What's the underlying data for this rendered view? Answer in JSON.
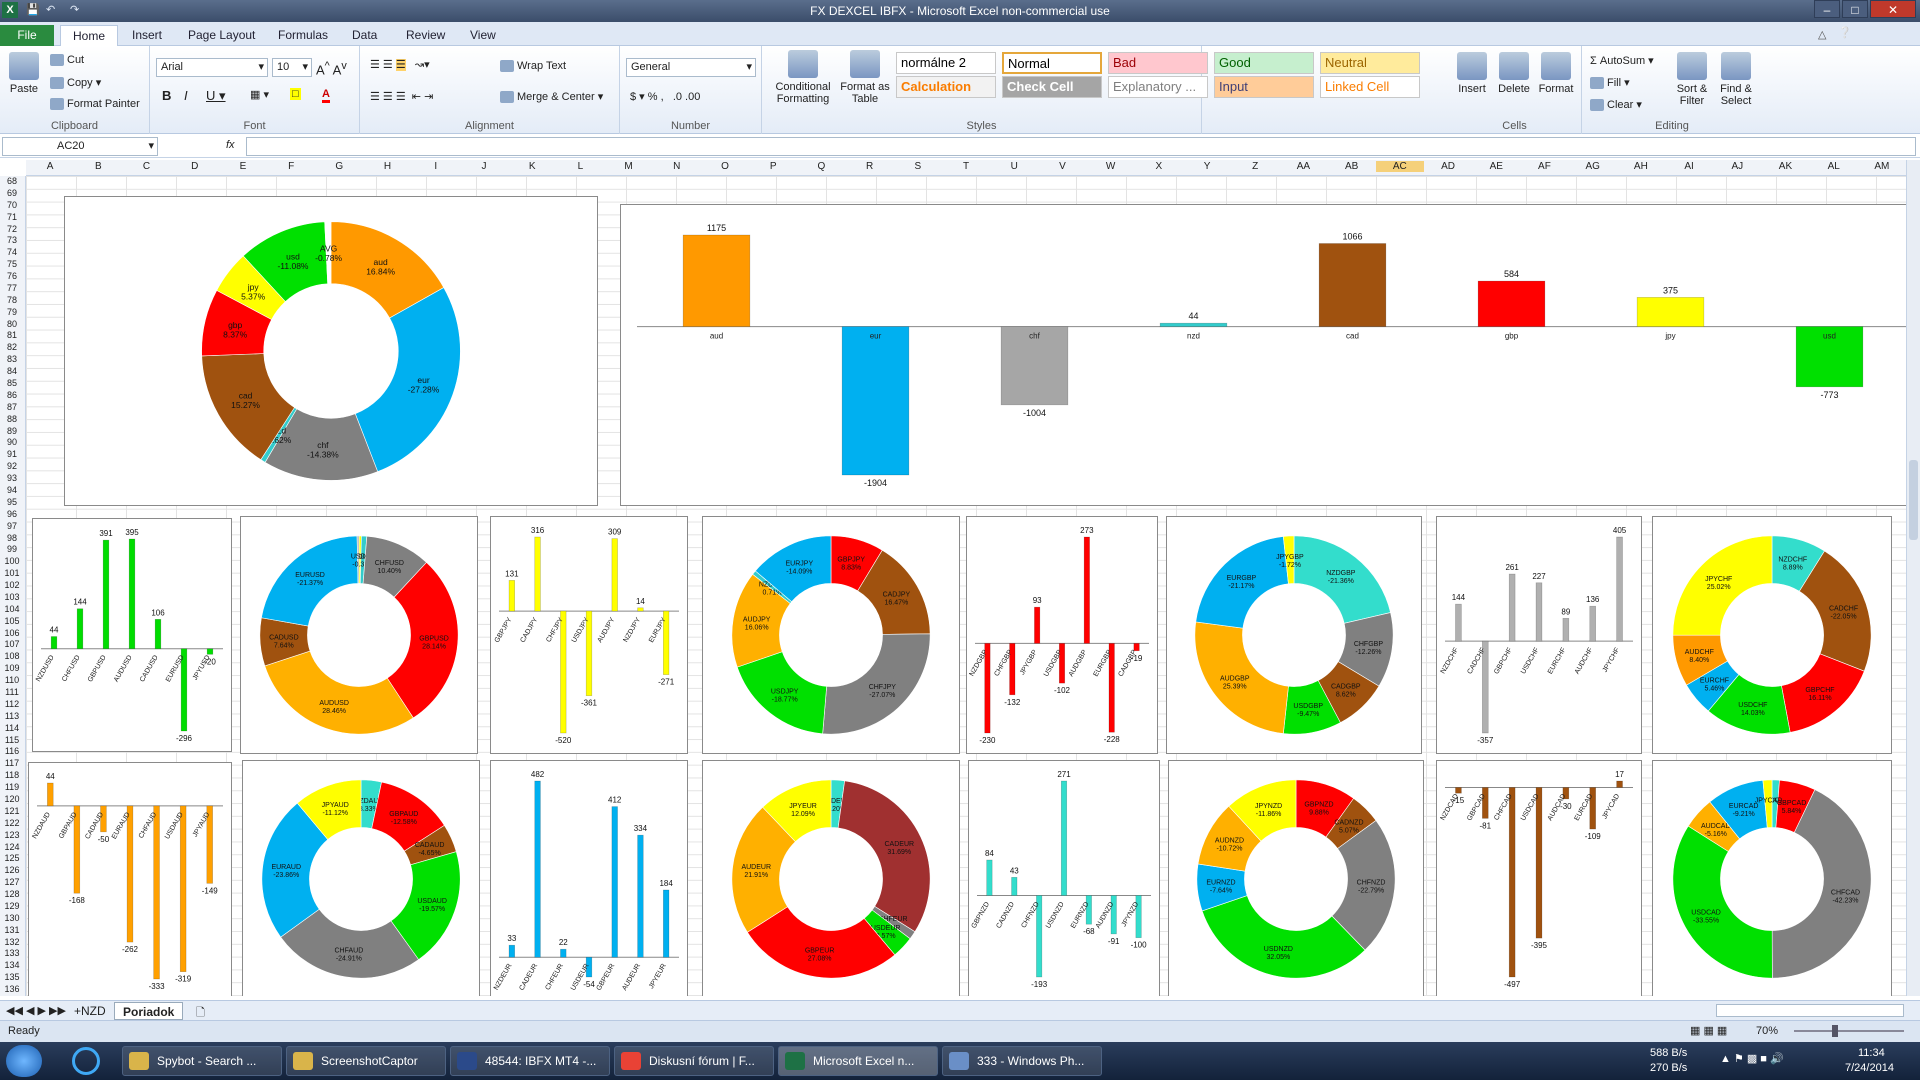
{
  "window": {
    "title": "FX DEXCEL IBFX  -  Microsoft Excel non-commercial use"
  },
  "ribbon_tabs": [
    "File",
    "Home",
    "Insert",
    "Page Layout",
    "Formulas",
    "Data",
    "Review",
    "View"
  ],
  "clipboard": {
    "paste": "Paste",
    "cut": "Cut",
    "copy": "Copy",
    "format_painter": "Format Painter",
    "label": "Clipboard"
  },
  "font": {
    "name": "Arial",
    "size": "10",
    "label": "Font"
  },
  "alignment": {
    "wrap": "Wrap Text",
    "merge": "Merge & Center",
    "label": "Alignment"
  },
  "number": {
    "format": "General",
    "label": "Number"
  },
  "styles_group": {
    "conditional": "Conditional Formatting",
    "format_table": "Format as Table",
    "label": "Styles",
    "items": [
      {
        "name": "normálne 2",
        "bg": "#ffffff",
        "fg": "#000000"
      },
      {
        "name": "Normal",
        "bg": "#ffffff",
        "fg": "#000000"
      },
      {
        "name": "Bad",
        "bg": "#ffc7ce",
        "fg": "#9c0006"
      },
      {
        "name": "Good",
        "bg": "#c6efce",
        "fg": "#006100"
      },
      {
        "name": "Neutral",
        "bg": "#ffeb9c",
        "fg": "#9c6500"
      },
      {
        "name": "Calculation",
        "bg": "#f2f2f2",
        "fg": "#fa7d00"
      },
      {
        "name": "Check Cell",
        "bg": "#a5a5a5",
        "fg": "#ffffff"
      },
      {
        "name": "Explanatory ...",
        "bg": "#ffffff",
        "fg": "#7f7f7f"
      },
      {
        "name": "Input",
        "bg": "#ffcc99",
        "fg": "#3f3f76"
      },
      {
        "name": "Linked Cell",
        "bg": "#ffffff",
        "fg": "#fa7d00"
      }
    ]
  },
  "cells_group": {
    "insert": "Insert",
    "delete": "Delete",
    "format": "Format",
    "label": "Cells"
  },
  "editing": {
    "autosum": "AutoSum",
    "fill": "Fill",
    "clear": "Clear",
    "sort": "Sort & Filter",
    "find": "Find & Select",
    "label": "Editing"
  },
  "formula_bar": {
    "name_box": "AC20",
    "fx": "fx"
  },
  "columns": [
    "A",
    "B",
    "C",
    "D",
    "E",
    "F",
    "G",
    "H",
    "I",
    "J",
    "K",
    "L",
    "M",
    "N",
    "O",
    "P",
    "Q",
    "R",
    "S",
    "T",
    "U",
    "V",
    "W",
    "X",
    "Y",
    "Z",
    "AA",
    "AB",
    "AC",
    "AD",
    "AE",
    "AF",
    "AG",
    "AH",
    "AI",
    "AJ",
    "AK",
    "AL",
    "AM"
  ],
  "row_start": 68,
  "row_end": 136,
  "sheets": [
    "+NZD",
    "Poriadok"
  ],
  "status": {
    "ready": "Ready",
    "zoom": "70%"
  },
  "taskbar": [
    {
      "label": "Spybot - Search ...",
      "color": "#d9b44a"
    },
    {
      "label": "ScreenshotCaptor",
      "color": "#d9b44a"
    },
    {
      "label": "48544: IBFX MT4 -...",
      "color": "#2b4a8a"
    },
    {
      "label": "Diskusní fórum | F...",
      "color": "#e94235"
    },
    {
      "label": "Microsoft Excel n...",
      "color": "#1e7145"
    },
    {
      "label": "333 - Windows Ph...",
      "color": "#6a8fc7"
    }
  ],
  "tray": {
    "up": "588 B/s",
    "down": "270 B/s",
    "time": "11:34",
    "date": "7/24/2014"
  },
  "chart_data": [
    {
      "type": "pie",
      "donut": true,
      "slices": [
        {
          "label": "aud",
          "value": 16.84,
          "pct": "16.84%",
          "color": "#ff9900"
        },
        {
          "label": "eur",
          "value": 27.28,
          "pct": "-27.28%",
          "color": "#00b0f0"
        },
        {
          "label": "chf",
          "value": 14.38,
          "pct": "-14.38%",
          "color": "#808080"
        },
        {
          "label": "nzd",
          "value": 0.62,
          "pct": "0.62%",
          "color": "#33cccc"
        },
        {
          "label": "cad",
          "value": 15.27,
          "pct": "15.27%",
          "color": "#a0520f"
        },
        {
          "label": "gbp",
          "value": 8.37,
          "pct": "8.37%",
          "color": "#ff0000"
        },
        {
          "label": "jpy",
          "value": 5.37,
          "pct": "5.37%",
          "color": "#ffff00"
        },
        {
          "label": "usd",
          "value": 11.08,
          "pct": "-11.08%",
          "color": "#00e000"
        },
        {
          "label": "AVG",
          "value": 0.78,
          "pct": "-0.78%",
          "color": "#ffffff"
        }
      ]
    },
    {
      "type": "bar",
      "categories": [
        "aud",
        "eur",
        "chf",
        "nzd",
        "cad",
        "gbp",
        "jpy",
        "usd"
      ],
      "values": [
        1175,
        -1904,
        -1004,
        44,
        1066,
        584,
        375,
        -773
      ],
      "colors": [
        "#ff9900",
        "#00b0f0",
        "#a6a6a6",
        "#33cccc",
        "#a0520f",
        "#ff0000",
        "#ffff00",
        "#00e000"
      ]
    },
    {
      "type": "bar",
      "categories": [
        "NZDUSD",
        "CHFUSD",
        "GBPUSD",
        "AUDUSD",
        "CADUSD",
        "EURUSD",
        "JPYUSD"
      ],
      "values": [
        44,
        144,
        391,
        395,
        106,
        -296,
        -20
      ],
      "colors": [
        "#00dd00"
      ]
    },
    {
      "type": "pie",
      "donut": true,
      "slices": [
        {
          "label": "JPYUSD",
          "value": 0.38,
          "pct": "",
          "color": "#ffff00"
        },
        {
          "label": "NZDUSD",
          "value": 0.85,
          "pct": "",
          "color": "#33cccc"
        },
        {
          "label": "CHFUSD",
          "value": 10.4,
          "pct": "10.40%",
          "color": "#808080"
        },
        {
          "label": "GBPUSD",
          "value": 28.14,
          "pct": "28.14%",
          "color": "#ff0000"
        },
        {
          "label": "AUDUSD",
          "value": 28.46,
          "pct": "28.46%",
          "color": "#ffb000"
        },
        {
          "label": "CADUSD",
          "value": 7.64,
          "pct": "7.64%",
          "color": "#a0520f"
        },
        {
          "label": "EURUSD",
          "value": 21.37,
          "pct": "-21.37%",
          "color": "#00b0f0"
        },
        {
          "label": "USD",
          "value": 0.3,
          "pct": "-0.3",
          "color": "#aaaaaa"
        }
      ]
    },
    {
      "type": "bar",
      "categories": [
        "GBPJPY",
        "CADJPY",
        "CHFJPY",
        "USDJPY",
        "AUDJPY",
        "NZDJPY",
        "EURJPY"
      ],
      "values": [
        131,
        316,
        -520,
        -361,
        309,
        14,
        -271
      ],
      "colors": [
        "#ffff00"
      ]
    },
    {
      "type": "pie",
      "donut": true,
      "slices": [
        {
          "label": "GBPJPY",
          "value": 8.83,
          "pct": "8.83%",
          "color": "#ff0000"
        },
        {
          "label": "CADJPY",
          "value": 16.47,
          "pct": "16.47%",
          "color": "#a0520f"
        },
        {
          "label": "CHFJPY",
          "value": 27.07,
          "pct": "-27.07%",
          "color": "#808080"
        },
        {
          "label": "USDJPY",
          "value": 18.77,
          "pct": "-18.77%",
          "color": "#00e000"
        },
        {
          "label": "AUDJPY",
          "value": 16.06,
          "pct": "16.06%",
          "color": "#ffb000"
        },
        {
          "label": "NZDJPY",
          "value": 0.71,
          "pct": "0.71%",
          "color": "#33cccc"
        },
        {
          "label": "EURJPY",
          "value": 14.09,
          "pct": "-14.09%",
          "color": "#00b0f0"
        }
      ]
    },
    {
      "type": "bar",
      "categories": [
        "NZDGBP",
        "CHFGBP",
        "JPYGBP",
        "USDGBP",
        "AUDGBP",
        "EURGBP",
        "CADGBP"
      ],
      "values": [
        -230,
        -132,
        93,
        -102,
        273,
        -228,
        -19
      ],
      "colors": [
        "#ff0000"
      ]
    },
    {
      "type": "pie",
      "donut": true,
      "slices": [
        {
          "label": "NZDGBP",
          "value": 21.36,
          "pct": "-21.36%",
          "color": "#33ddcc"
        },
        {
          "label": "CHFGBP",
          "value": 12.26,
          "pct": "-12.26%",
          "color": "#808080"
        },
        {
          "label": "CADGBP",
          "value": 8.62,
          "pct": "8.62%",
          "color": "#a0520f"
        },
        {
          "label": "USDGBP",
          "value": 9.47,
          "pct": "-9.47%",
          "color": "#00e000"
        },
        {
          "label": "AUDGBP",
          "value": 25.39,
          "pct": "25.39%",
          "color": "#ffb000"
        },
        {
          "label": "EURGBP",
          "value": 21.17,
          "pct": "-21.17%",
          "color": "#00b0f0"
        },
        {
          "label": "JPYGBP",
          "value": 1.72,
          "pct": "-1.72%",
          "color": "#ffff00"
        }
      ]
    },
    {
      "type": "bar",
      "categories": [
        "NZDCHF",
        "CADCHF",
        "GBPCHF",
        "USDCHF",
        "EURCHF",
        "AUDCHF",
        "JPYCHF"
      ],
      "values": [
        144,
        -357,
        261,
        227,
        89,
        136,
        405
      ],
      "colors": [
        "#b0b0b0"
      ]
    },
    {
      "type": "pie",
      "donut": true,
      "slices": [
        {
          "label": "NZDCHF",
          "value": 8.89,
          "pct": "8.89%",
          "color": "#33ddcc"
        },
        {
          "label": "CADCHF",
          "value": 22.05,
          "pct": "-22.05%",
          "color": "#a0520f"
        },
        {
          "label": "GBPCHF",
          "value": 16.11,
          "pct": "16.11%",
          "color": "#ff0000"
        },
        {
          "label": "USDCHF",
          "value": 14.03,
          "pct": "14.03%",
          "color": "#00e000"
        },
        {
          "label": "EURCHF",
          "value": 5.46,
          "pct": "5.46%",
          "color": "#00b0f0"
        },
        {
          "label": "AUDCHF",
          "value": 8.4,
          "pct": "8.40%",
          "color": "#ff9900"
        },
        {
          "label": "JPYCHF",
          "value": 25.02,
          "pct": "25.02%",
          "color": "#ffff00"
        }
      ]
    },
    {
      "type": "bar",
      "categories": [
        "NZDAUD",
        "GBPAUD",
        "CADAUD",
        "EURAUD",
        "CHFAUD",
        "USDAUD",
        "JPYAUD"
      ],
      "values": [
        44,
        -168,
        -50,
        -262,
        -333,
        -319,
        -149
      ],
      "colors": [
        "#ffa000"
      ]
    },
    {
      "type": "pie",
      "donut": true,
      "slices": [
        {
          "label": "NZDAUD",
          "value": 3.33,
          "pct": "3.33%",
          "color": "#33ddcc"
        },
        {
          "label": "GBPAUD",
          "value": 12.58,
          "pct": "-12.58%",
          "color": "#ff0000"
        },
        {
          "label": "CADAUD",
          "value": 4.65,
          "pct": "-4.65%",
          "color": "#a0520f"
        },
        {
          "label": "USDAUD",
          "value": 19.57,
          "pct": "-19.57%",
          "color": "#00e000"
        },
        {
          "label": "CHFAUD",
          "value": 24.91,
          "pct": "-24.91%",
          "color": "#808080"
        },
        {
          "label": "EURAUD",
          "value": 23.86,
          "pct": "-23.86%",
          "color": "#00b0f0"
        },
        {
          "label": "JPYAUD",
          "value": 11.12,
          "pct": "-11.12%",
          "color": "#ffff00"
        }
      ]
    },
    {
      "type": "bar",
      "categories": [
        "NZDEUR",
        "CADEUR",
        "CHFEUR",
        "USDEUR",
        "GBPEUR",
        "AUDEUR",
        "JPYEUR"
      ],
      "values": [
        33,
        482,
        22,
        -54,
        412,
        334,
        184
      ],
      "colors": [
        "#00b0f0"
      ]
    },
    {
      "type": "pie",
      "donut": true,
      "slices": [
        {
          "label": "NZDEUR",
          "value": 2.2,
          "pct": "2.20%",
          "color": "#33ddcc"
        },
        {
          "label": "CADEUR",
          "value": 31.69,
          "pct": "31.69%",
          "color": "#a03030"
        },
        {
          "label": "CHFEUR",
          "value": 1.37,
          "pct": "",
          "color": "#808080"
        },
        {
          "label": "USDEUR",
          "value": 3.57,
          "pct": "3.57%",
          "color": "#00e000"
        },
        {
          "label": "GBPEUR",
          "value": 27.08,
          "pct": "27.08%",
          "color": "#ff0000"
        },
        {
          "label": "AUDEUR",
          "value": 21.91,
          "pct": "21.91%",
          "color": "#ffb000"
        },
        {
          "label": "JPYEUR",
          "value": 12.09,
          "pct": "12.09%",
          "color": "#ffff00"
        }
      ]
    },
    {
      "type": "bar",
      "categories": [
        "GBPNZD",
        "CADNZD",
        "CHFNZD",
        "USDNZD",
        "EURNZD",
        "AUDNZD",
        "JPYNZD"
      ],
      "values": [
        84,
        43,
        -193,
        271,
        -68,
        -91,
        -100
      ],
      "colors": [
        "#33ddcc"
      ]
    },
    {
      "type": "pie",
      "donut": true,
      "slices": [
        {
          "label": "GBPNZD",
          "value": 9.88,
          "pct": "9.88%",
          "color": "#ff0000"
        },
        {
          "label": "CADNZD",
          "value": 5.07,
          "pct": "5.07%",
          "color": "#a0520f"
        },
        {
          "label": "CHFNZD",
          "value": 22.79,
          "pct": "-22.79%",
          "color": "#808080"
        },
        {
          "label": "USDNZD",
          "value": 32.05,
          "pct": "32.05%",
          "color": "#00e000"
        },
        {
          "label": "EURNZD",
          "value": 7.64,
          "pct": "-7.64%",
          "color": "#00b0f0"
        },
        {
          "label": "AUDNZD",
          "value": 10.72,
          "pct": "-10.72%",
          "color": "#ffb000"
        },
        {
          "label": "JPYNZD",
          "value": 11.86,
          "pct": "-11.86%",
          "color": "#ffff00"
        }
      ]
    },
    {
      "type": "bar",
      "categories": [
        "NZDCAD",
        "GBPCAD",
        "CHFCAD",
        "USDCAD",
        "AUDCAD",
        "EURCAD",
        "JPYCAD"
      ],
      "values": [
        -15,
        -81,
        -497,
        -395,
        -30,
        -109,
        17
      ],
      "colors": [
        "#a0520f"
      ]
    },
    {
      "type": "pie",
      "donut": true,
      "slices": [
        {
          "label": "NZDCAD",
          "value": 1.19,
          "pct": "",
          "color": "#33ddcc"
        },
        {
          "label": "GBPCAD",
          "value": 5.84,
          "pct": "5.84%",
          "color": "#ff0000"
        },
        {
          "label": "CHFCAD",
          "value": 42.23,
          "pct": "-42.23%",
          "color": "#808080"
        },
        {
          "label": "USDCAD",
          "value": 33.55,
          "pct": "-33.55%",
          "color": "#00e000"
        },
        {
          "label": "AUDCAD",
          "value": 5.16,
          "pct": "-5.16%",
          "color": "#ffb000"
        },
        {
          "label": "EURCAD",
          "value": 9.21,
          "pct": "-9.21%",
          "color": "#00b0f0"
        },
        {
          "label": "JPYCAD",
          "value": 1.44,
          "pct": "",
          "color": "#ffff00"
        }
      ]
    }
  ]
}
